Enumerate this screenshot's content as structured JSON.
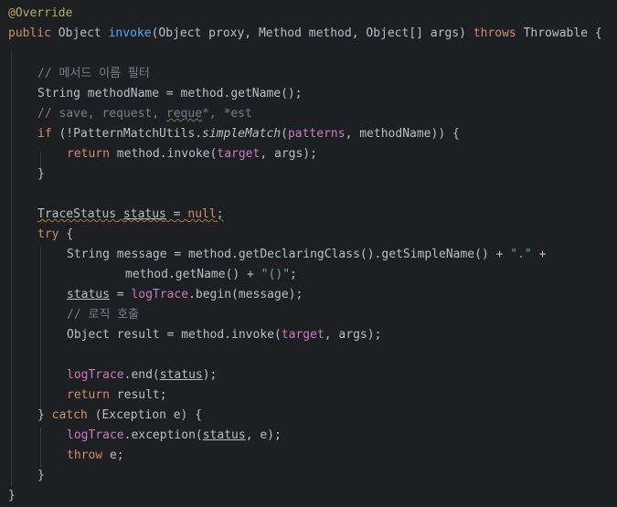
{
  "code": {
    "override_annotation": "@Override",
    "kw_public": "public",
    "type_object": "Object",
    "method_invoke": "invoke",
    "params_text": "(Object proxy, Method method, Object[] args)",
    "kw_throws": "throws",
    "type_throwable": "Throwable",
    "open_brace": "{",
    "close_brace": "}",
    "comment_filter": "// 메서드 이름 필터",
    "method_name_decl": "String methodName = method.getName();",
    "comment_patterns_prefix": "// save, request, ",
    "comment_patterns_typo": "reque",
    "comment_patterns_suffix": "*, *est",
    "kw_if": "if",
    "if_open": "(!PatternMatchUtils.",
    "simple_match": "simpleMatch",
    "if_paren": "(",
    "patterns_field": "patterns",
    "if_rest": ", methodName)) {",
    "kw_return": "return",
    "return_invoke_start": "method.invoke(",
    "target_field": "target",
    "return_invoke_end": ", args);",
    "trace_status_type": "TraceStatus",
    "status_var": "status",
    "assign_eq": "=",
    "kw_null": "null",
    "semicolon": ";",
    "kw_try": "try",
    "message_decl": "String message = method.getDeclaringClass().getSimpleName() + ",
    "dot_string": "\".\"",
    "plus": "+",
    "message_cont": "method.getName() + ",
    "paren_string": "\"()\"",
    "begin_assign": " = ",
    "logtrace_field": "logTrace",
    "begin_call": ".begin(message);",
    "comment_logic": "// 로직 호출",
    "result_decl": "Object result = method.invoke(",
    "end_call_open": ".end(",
    "paren_close_semi": ");",
    "return_result": "result;",
    "kw_catch": "catch",
    "catch_params": "(Exception e) {",
    "exception_call_open": ".exception(",
    "exception_call_end": ", e);",
    "kw_throw": "throw",
    "throw_var": "e;"
  },
  "colors": {
    "background": "#1e1f22",
    "default_text": "#bcbec4",
    "keyword": "#cf8e6d",
    "annotation": "#b3ae60",
    "method_declaration": "#56a8f5",
    "field": "#c77dbb",
    "string": "#6aab73",
    "comment": "#7a7e85"
  }
}
